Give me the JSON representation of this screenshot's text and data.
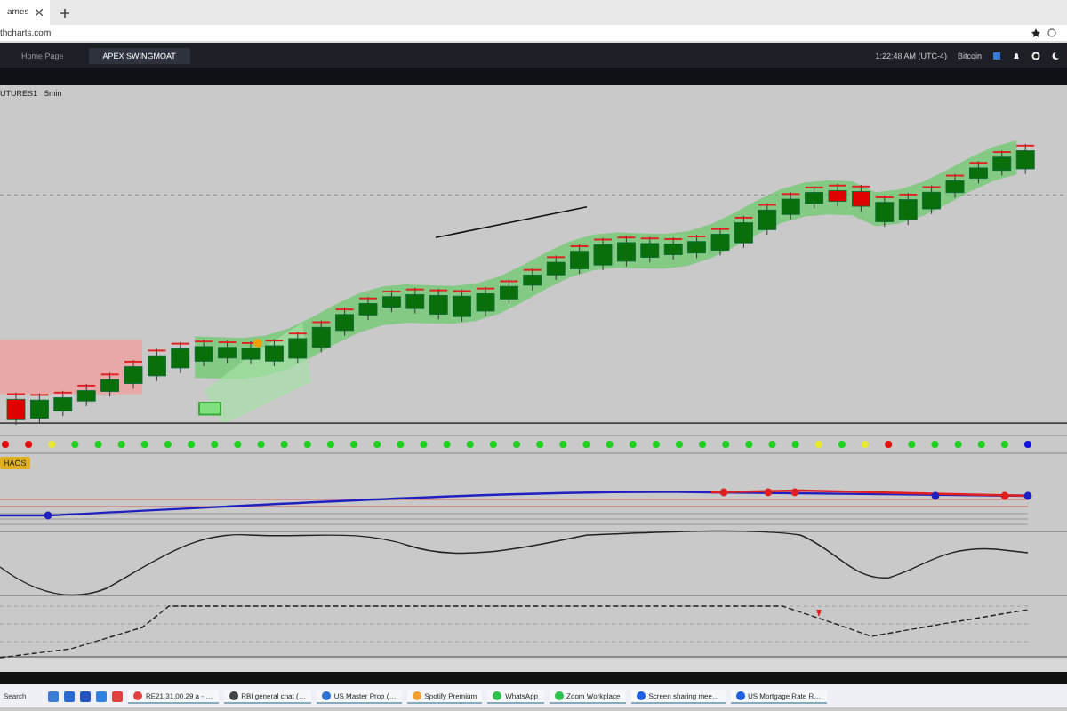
{
  "browser": {
    "tab_title": "ames",
    "url": "thcharts.com"
  },
  "app_tabs": [
    {
      "label": "Home Page",
      "selected": false
    },
    {
      "label": "APEX SWINGMOAT",
      "selected": true
    }
  ],
  "app_status": {
    "time": "1:22:48 AM (UTC-4)",
    "account": "Bitcoin"
  },
  "chart": {
    "symbol": "UTURES1",
    "interval": "5min"
  },
  "signal_dots": [
    {
      "color": "#e01010"
    },
    {
      "color": "#e01010"
    },
    {
      "color": "#e8e830"
    },
    {
      "color": "#20d020"
    },
    {
      "color": "#20d020"
    },
    {
      "color": "#20d020"
    },
    {
      "color": "#20d020"
    },
    {
      "color": "#20d020"
    },
    {
      "color": "#20d020"
    },
    {
      "color": "#20d020"
    },
    {
      "color": "#20d020"
    },
    {
      "color": "#20d020"
    },
    {
      "color": "#20d020"
    },
    {
      "color": "#20d020"
    },
    {
      "color": "#20d020"
    },
    {
      "color": "#20d020"
    },
    {
      "color": "#20d020"
    },
    {
      "color": "#20d020"
    },
    {
      "color": "#20d020"
    },
    {
      "color": "#20d020"
    },
    {
      "color": "#20d020"
    },
    {
      "color": "#20d020"
    },
    {
      "color": "#20d020"
    },
    {
      "color": "#20d020"
    },
    {
      "color": "#20d020"
    },
    {
      "color": "#20d020"
    },
    {
      "color": "#20d020"
    },
    {
      "color": "#20d020"
    },
    {
      "color": "#20d020"
    },
    {
      "color": "#20d020"
    },
    {
      "color": "#20d020"
    },
    {
      "color": "#20d020"
    },
    {
      "color": "#20d020"
    },
    {
      "color": "#20d020"
    },
    {
      "color": "#20d020"
    },
    {
      "color": "#e8e830"
    },
    {
      "color": "#20d020"
    },
    {
      "color": "#e8e830"
    },
    {
      "color": "#e01010"
    },
    {
      "color": "#20d020"
    },
    {
      "color": "#20d020"
    },
    {
      "color": "#20d020"
    },
    {
      "color": "#20d020"
    },
    {
      "color": "#20d020"
    },
    {
      "color": "#1010e0"
    }
  ],
  "indicator_badge": "HAOS",
  "taskbar": {
    "search": "Search",
    "windows": [
      "RE21 31.00.29 a - …",
      "RBI general chat (…",
      "US Master Prop (…",
      "Spotify Premium",
      "WhatsApp",
      "Zoom Workplace",
      "Screen sharing mee…",
      "US Mortgage Rate R…"
    ]
  }
}
